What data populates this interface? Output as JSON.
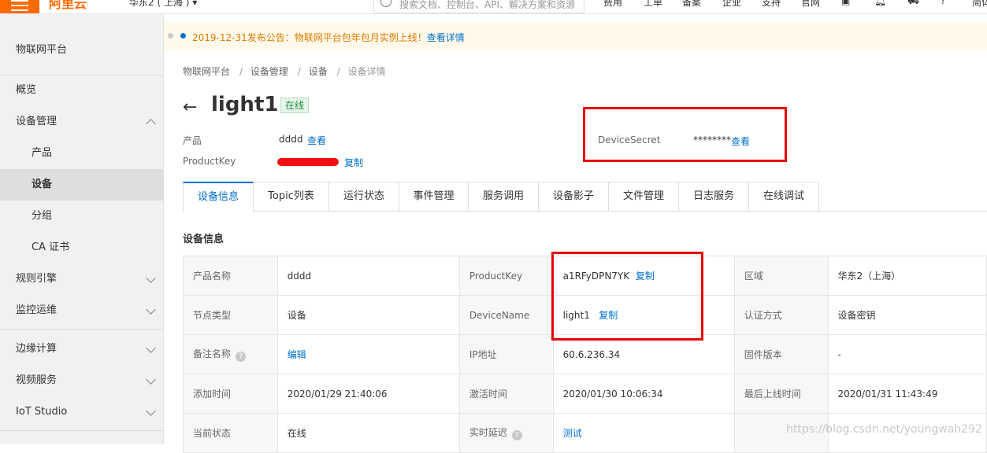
{
  "topbar": {
    "logo": "阿里云",
    "region": "华东2 ( 上海 ) ▾",
    "search_placeholder": "搜索文档、控制台、API、解决方案和资源",
    "nav": [
      "费用",
      "工单",
      "备案",
      "企业",
      "支持",
      "官网",
      "简体"
    ]
  },
  "sidebar": {
    "title": "物联网平台",
    "items": [
      {
        "label": "概览"
      },
      {
        "label": "设备管理"
      },
      {
        "label": "产品"
      },
      {
        "label": "设备"
      },
      {
        "label": "分组"
      },
      {
        "label": "CA 证书"
      },
      {
        "label": "规则引擎"
      },
      {
        "label": "监控运维"
      },
      {
        "label": "边缘计算"
      },
      {
        "label": "视频服务"
      },
      {
        "label": "IoT Studio"
      }
    ]
  },
  "notice": {
    "text": "2019-12-31发布公告：物联网平台包年包月实例上线！",
    "link": "查看详情"
  },
  "breadcrumb": [
    "物联网平台",
    "设备管理",
    "设备",
    "设备详情"
  ],
  "device": {
    "name": "light1",
    "status": "在线",
    "product_label": "产品",
    "product_value": "dddd",
    "product_link": "查看",
    "productkey_label": "ProductKey",
    "productkey_link": "复制",
    "secret_label": "DeviceSecret",
    "secret_value": "********",
    "secret_link": "查看"
  },
  "tabs": [
    "设备信息",
    "Topic列表",
    "运行状态",
    "事件管理",
    "服务调用",
    "设备影子",
    "文件管理",
    "日志服务",
    "在线调试"
  ],
  "section_title": "设备信息",
  "info": {
    "rows": [
      {
        "k1": "产品名称",
        "v1": "dddd",
        "k2": "ProductKey",
        "v2": "a1RFyDPN7YK",
        "v2_link": "复制",
        "k3": "区域",
        "v3": "华东2（上海）"
      },
      {
        "k1": "节点类型",
        "v1": "设备",
        "k2": "DeviceName",
        "v2": "light1",
        "v2_link": "复制",
        "k3": "认证方式",
        "v3": "设备密钥"
      },
      {
        "k1": "备注名称",
        "v1": "编辑",
        "k2": "IP地址",
        "v2": "60.6.236.34",
        "k3": "固件版本",
        "v3": "-"
      },
      {
        "k1": "添加时间",
        "v1": "2020/01/29 21:40:06",
        "k2": "激活时间",
        "v2": "2020/01/30 10:06:34",
        "k3": "最后上线时间",
        "v3": "2020/01/31 11:43:49"
      },
      {
        "k1": "当前状态",
        "v1": "在线",
        "k2": "实时延迟",
        "v2": "测试",
        "k3": "",
        "v3": ""
      }
    ]
  },
  "watermark": "https://blog.csdn.net/youngwah292",
  "colors": {
    "accent": "#0070cc",
    "brand": "#ff6a00",
    "highlight": "#e8000b"
  }
}
